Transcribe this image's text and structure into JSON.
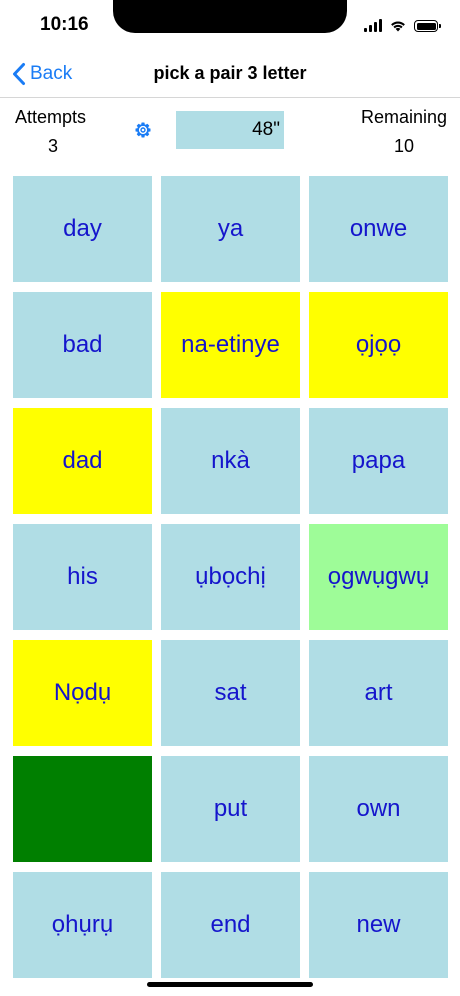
{
  "status_bar": {
    "time": "10:16"
  },
  "nav": {
    "back_label": "Back",
    "title": "pick a pair 3 letter",
    "accent_color": "#1a7cf5"
  },
  "stats": {
    "attempts_label": "Attempts",
    "attempts_value": "3",
    "timer": "48\"",
    "remaining_label": "Remaining",
    "remaining_value": "10"
  },
  "colors": {
    "tile_default": "#b0dde5",
    "tile_selected": "#ffff00",
    "tile_matched": "#9efc98",
    "tile_cleared": "#007f00",
    "tile_text": "#1515cc"
  },
  "tiles": [
    {
      "text": "day",
      "state": "default"
    },
    {
      "text": "ya",
      "state": "default"
    },
    {
      "text": "onwe",
      "state": "default"
    },
    {
      "text": "bad",
      "state": "default"
    },
    {
      "text": "na-etinye",
      "state": "selected"
    },
    {
      "text": "ọjọọ",
      "state": "selected"
    },
    {
      "text": "dad",
      "state": "selected"
    },
    {
      "text": "nkà",
      "state": "default"
    },
    {
      "text": "papa",
      "state": "default"
    },
    {
      "text": "his",
      "state": "default"
    },
    {
      "text": "ụbọchị",
      "state": "default"
    },
    {
      "text": "ọgwụgwụ",
      "state": "matched"
    },
    {
      "text": "Nọdụ",
      "state": "selected"
    },
    {
      "text": "sat",
      "state": "default"
    },
    {
      "text": "art",
      "state": "default"
    },
    {
      "text": "",
      "state": "cleared"
    },
    {
      "text": "put",
      "state": "default"
    },
    {
      "text": "own",
      "state": "default"
    },
    {
      "text": "ọhụrụ",
      "state": "default"
    },
    {
      "text": "end",
      "state": "default"
    },
    {
      "text": "new",
      "state": "default"
    }
  ]
}
